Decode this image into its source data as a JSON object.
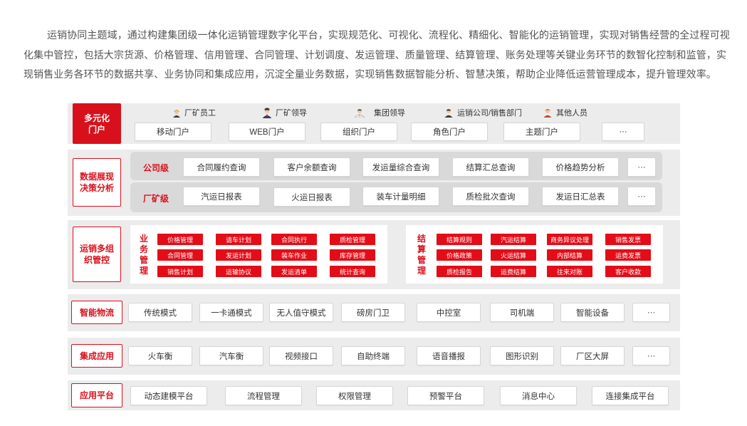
{
  "intro": "运销协同主题域，通过构建集团级一体化运销管理数字化平台，实现规范化、可视化、流程化、精细化、智能化的运销管理，实现对销售经营的全过程可视化集中管控，包括大宗货源、价格管理、信用管理、合同管理、计划调度、发运管理、质量管理、结算管理、账务处理等关键业务环节的数智化控制和监管，实现销售业务各环节的数据共享、业务协同和集成应用，沉淀全量业务数据，实现销售数据智能分析、智慧决策，帮助企业降低运营管理成本，提升管理效率。",
  "colors": {
    "accent": "#d8101c",
    "row_bg": "#ececec",
    "band_bg": "#d9d9d9"
  },
  "portal": {
    "label": "多元化门户",
    "personas": [
      {
        "label": "厂矿员工",
        "icon": "worker-icon"
      },
      {
        "label": "厂矿领导",
        "icon": "manager-icon"
      },
      {
        "label": "集团领导",
        "icon": "leader-icon"
      },
      {
        "label": "运销公司/销售部门",
        "icon": "staff-icon"
      },
      {
        "label": "其他人员",
        "icon": "person-icon"
      }
    ],
    "items": [
      "移动门户",
      "WEB门户",
      "组织门户",
      "角色门户",
      "主题门户",
      "···"
    ]
  },
  "analytics": {
    "label": "数据展现决策分析",
    "company": {
      "label": "公司级",
      "items": [
        "合同履约查询",
        "客户余额查询",
        "发运量综合查询",
        "结算汇总查询",
        "价格趋势分析",
        "···"
      ]
    },
    "mine": {
      "label": "厂矿级",
      "items": [
        "汽运日报表",
        "火运日报表",
        "装车计量明细",
        "质检批次查询",
        "发运日汇总表",
        "···"
      ]
    }
  },
  "org": {
    "label": "运销多组织管控",
    "business": {
      "title": "业务管理",
      "items": [
        "价格管理",
        "请车计划",
        "合同执行",
        "质检管理",
        "合同管理",
        "发运计划",
        "装车作业",
        "库存管理",
        "销售计划",
        "运输协议",
        "发运清单",
        "统计查询"
      ]
    },
    "settlement": {
      "title": "结算管理",
      "items": [
        "结算规则",
        "汽运结算",
        "商务异议处理",
        "销售发票",
        "价格政策",
        "火运结算",
        "内部结算",
        "运费发票",
        "质检报告",
        "运费结算",
        "往来对账",
        "客户收款"
      ]
    }
  },
  "logistics": {
    "label": "智能物流",
    "items": [
      "传统模式",
      "一卡通模式",
      "无人值守模式",
      "磅房门卫",
      "中控室",
      "司机端",
      "智能设备",
      "···"
    ]
  },
  "integration": {
    "label": "集成应用",
    "items": [
      "火车衡",
      "汽车衡",
      "视频接口",
      "自助终端",
      "语音播报",
      "图形识别",
      "厂区大屏",
      "···"
    ]
  },
  "platform": {
    "label": "应用平台",
    "items": [
      "动态建模平台",
      "流程管理",
      "权限管理",
      "预警平台",
      "消息中心",
      "连接集成平台"
    ]
  }
}
